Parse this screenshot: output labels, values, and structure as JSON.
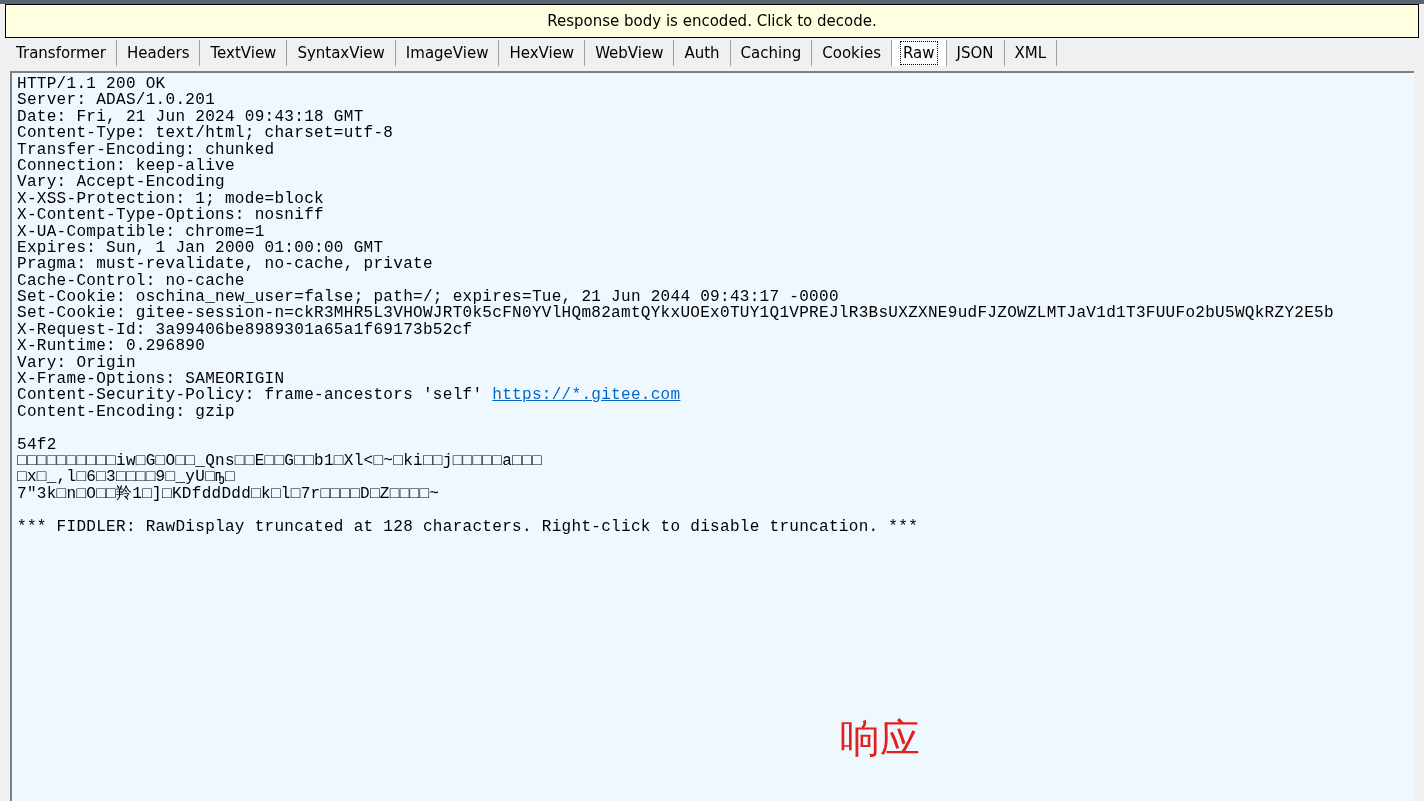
{
  "notice": "Response body is encoded. Click to decode.",
  "tabs": [
    {
      "label": "Transformer",
      "selected": false
    },
    {
      "label": "Headers",
      "selected": false
    },
    {
      "label": "TextView",
      "selected": false
    },
    {
      "label": "SyntaxView",
      "selected": false
    },
    {
      "label": "ImageView",
      "selected": false
    },
    {
      "label": "HexView",
      "selected": false
    },
    {
      "label": "WebView",
      "selected": false
    },
    {
      "label": "Auth",
      "selected": false
    },
    {
      "label": "Caching",
      "selected": false
    },
    {
      "label": "Cookies",
      "selected": false
    },
    {
      "label": "Raw",
      "selected": true
    },
    {
      "label": "JSON",
      "selected": false
    },
    {
      "label": "XML",
      "selected": false
    }
  ],
  "raw_blocks": [
    [
      {
        "text": "HTTP/1.1 200 OK"
      },
      {
        "text": "Server: ADAS/1.0.201"
      },
      {
        "text": "Date: Fri, 21 Jun 2024 09:43:18 GMT"
      },
      {
        "text": "Content-Type: text/html; charset=utf-8"
      },
      {
        "text": "Transfer-Encoding: chunked"
      },
      {
        "text": "Connection: keep-alive"
      },
      {
        "text": "Vary: Accept-Encoding"
      },
      {
        "text": "X-XSS-Protection: 1; mode=block"
      },
      {
        "text": "X-Content-Type-Options: nosniff"
      },
      {
        "text": "X-UA-Compatible: chrome=1"
      },
      {
        "text": "Expires: Sun, 1 Jan 2000 01:00:00 GMT"
      },
      {
        "text": "Pragma: must-revalidate, no-cache, private"
      },
      {
        "text": "Cache-Control: no-cache"
      },
      {
        "text": "Set-Cookie: oschina_new_user=false; path=/; expires=Tue, 21 Jun 2044 09:43:17 -0000"
      },
      {
        "text": "Set-Cookie: gitee-session-n=ckR3MHR5L3VHOWJRT0k5cFN0YVlHQm82amtQYkxUOEx0TUY1Q1VPREJlR3BsUXZXNE9udFJZOWZLMTJaV1d1T3FUUFo2bU5WQkRZY2E5b"
      },
      {
        "text": "X-Request-Id: 3a99406be8989301a65a1f69173b52cf"
      },
      {
        "text": "X-Runtime: 0.296890"
      },
      {
        "text": "Vary: Origin"
      },
      {
        "text": "X-Frame-Options: SAMEORIGIN"
      },
      {
        "text": "Content-Security-Policy: frame-ancestors 'self' ",
        "link": "https://*.gitee.com"
      },
      {
        "text": "Content-Encoding: gzip"
      }
    ],
    [
      {
        "text": "54f2"
      },
      {
        "text": "□□□□□□□□□□iw□G□O□□_Qns□□E□□G□□b1□Xl<□~□ki□□j□□□□□a□□□"
      },
      {
        "text": "□x□_,l□6□3□□□□9□_yU□ҧ□"
      },
      {
        "text": "7\"3k□n□O□□羚1□]□KDfddDdd□k□l□7r□□□□D□Z□□□□~"
      }
    ],
    [
      {
        "text": "*** FIDDLER: RawDisplay truncated at 128 characters. Right-click to disable truncation. ***"
      }
    ]
  ],
  "annotation": "响应"
}
